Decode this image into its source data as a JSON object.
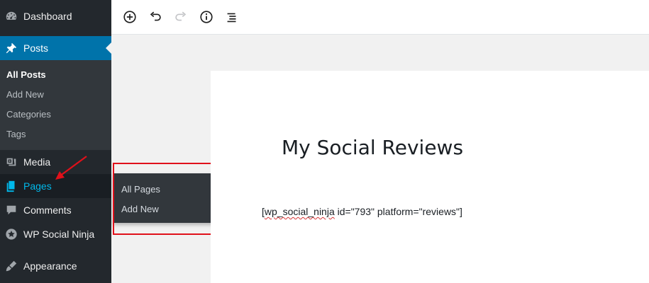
{
  "sidebar": {
    "items": [
      {
        "label": "Dashboard",
        "icon": "dashboard-icon"
      },
      {
        "label": "Posts",
        "icon": "pin-icon"
      },
      {
        "label": "Media",
        "icon": "media-icon"
      },
      {
        "label": "Pages",
        "icon": "pages-icon"
      },
      {
        "label": "Comments",
        "icon": "comments-icon"
      },
      {
        "label": "WP Social Ninja",
        "icon": "star-badge-icon"
      },
      {
        "label": "Appearance",
        "icon": "brush-icon"
      }
    ],
    "posts_submenu": [
      "All Posts",
      "Add New",
      "Categories",
      "Tags"
    ]
  },
  "flyout": {
    "items": [
      "All Pages",
      "Add New"
    ]
  },
  "toolbar": {
    "buttons": [
      "add-block-icon",
      "undo-icon",
      "redo-icon",
      "info-icon",
      "outline-icon"
    ]
  },
  "editor": {
    "title": "My Social Reviews",
    "shortcode_misspelled": "wp_social_ninja",
    "shortcode_open": "[",
    "shortcode_rest": " id=\"793\" platform=\"reviews\"]"
  },
  "colors": {
    "sidebar_bg": "#23282d",
    "submenu_bg": "#32373c",
    "current_accent": "#0073aa",
    "hover_text": "#00b9eb",
    "annotation_red": "#e0101a"
  }
}
